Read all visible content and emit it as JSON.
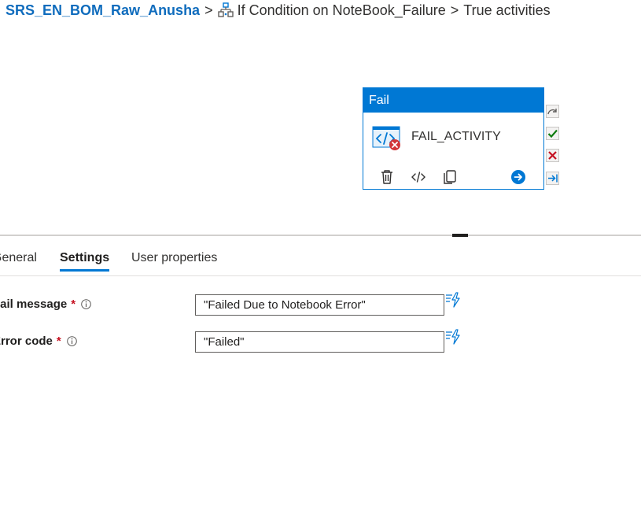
{
  "breadcrumb": {
    "pipeline": "SRS_EN_BOM_Raw_Anusha",
    "separator": ">",
    "condition_icon": "if-condition-icon",
    "condition": "If Condition on NoteBook_Failure",
    "branch": "True activities"
  },
  "activity": {
    "type": "Fail",
    "name": "FAIL_ACTIVITY",
    "icon": "fail-activity-icon",
    "actions": [
      "delete-icon",
      "code-icon",
      "copy-icon",
      "go-arrow-icon"
    ],
    "ports": [
      "skip-port-icon",
      "success-port-icon",
      "failure-port-icon",
      "completion-port-icon"
    ]
  },
  "tabs": [
    {
      "label": "General",
      "active": false
    },
    {
      "label": "Settings",
      "active": true
    },
    {
      "label": "User properties",
      "active": false
    }
  ],
  "form": {
    "fail_message": {
      "label": "Fail message",
      "required": "*",
      "value": "\"Failed Due to Notebook Error\""
    },
    "error_code": {
      "label": "Error code",
      "required": "*",
      "value": "\"Failed\""
    }
  },
  "colors": {
    "accent": "#0078d4",
    "link": "#0f6cbd",
    "success": "#107c10",
    "error": "#c50f1f",
    "required": "#c50f1f"
  }
}
